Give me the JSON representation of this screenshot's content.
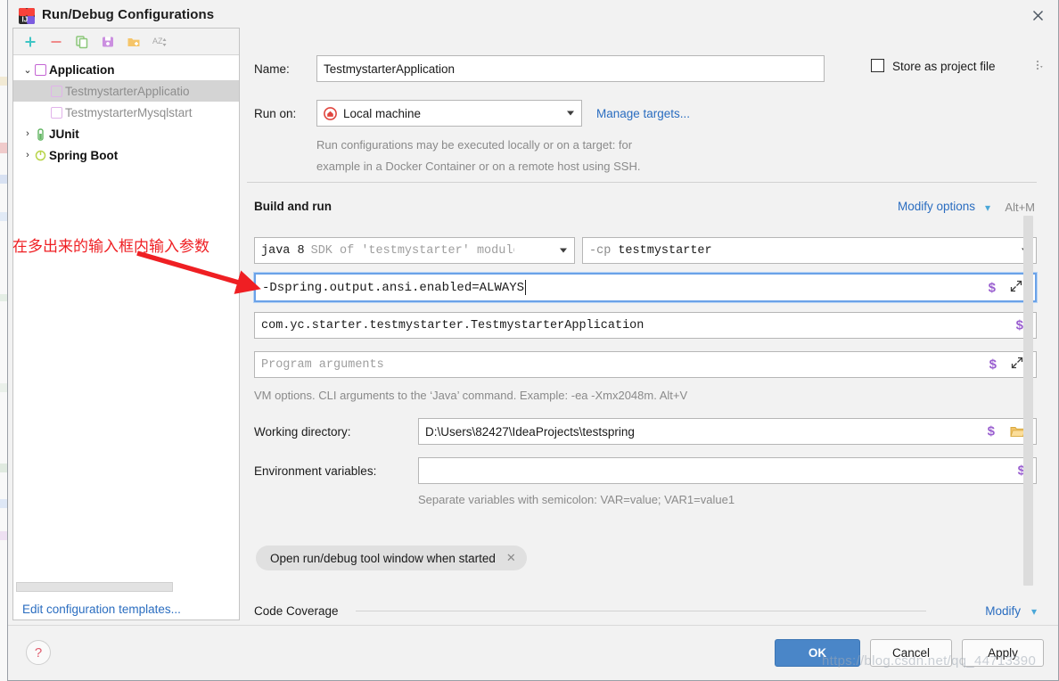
{
  "window": {
    "title": "Run/Debug Configurations",
    "logo_icon": "jetbrains-intellij-logo",
    "close_icon": "close-icon"
  },
  "sidebar": {
    "toolbar": [
      {
        "name": "add",
        "icon": "plus-icon",
        "glyph": "+"
      },
      {
        "name": "remove",
        "icon": "minus-icon",
        "glyph": "−"
      },
      {
        "name": "copy",
        "icon": "copy-icon",
        "glyph": "❐"
      },
      {
        "name": "save",
        "icon": "save-floppy-icon",
        "glyph": "☰"
      },
      {
        "name": "folder",
        "icon": "new-folder-icon",
        "glyph": "+"
      },
      {
        "name": "sort",
        "icon": "sort-alphabetically-icon",
        "glyph": "AZ"
      }
    ],
    "tree": [
      {
        "label": "Application",
        "type": "group",
        "expanded": true,
        "twisty": "⌄",
        "icon": "application-icon"
      },
      {
        "label": "TestmystarterApplicatio",
        "type": "child",
        "selected": true,
        "icon": "run-config-icon"
      },
      {
        "label": "TestmystarterMysqlstart",
        "type": "child",
        "selected": false,
        "icon": "run-config-icon"
      },
      {
        "label": "JUnit",
        "type": "group",
        "expanded": false,
        "twisty": "›",
        "icon": "junit-icon"
      },
      {
        "label": "Spring Boot",
        "type": "group",
        "expanded": false,
        "twisty": "›",
        "icon": "spring-boot-icon"
      }
    ],
    "edit_templates_link": "Edit configuration templates..."
  },
  "form": {
    "name_label": "Name:",
    "name_value": "TestmystarterApplication",
    "store_as_project_file_label": "Store as project file",
    "store_as_project_file_checked": false,
    "run_on_label": "Run on:",
    "run_on_value": "Local machine",
    "run_on_icon": "local-machine-home-icon",
    "manage_targets_link": "Manage targets...",
    "run_on_hint_line1": "Run configurations may be executed locally or on a target: for",
    "run_on_hint_line2": "example in a Docker Container or on a remote host using SSH."
  },
  "build_and_run": {
    "section_title": "Build and run",
    "modify_options_link": "Modify options",
    "modify_options_shortcut": "Alt+M",
    "jre_prefix": "java 8",
    "jre_suffix": "SDK of 'testmystarter' module",
    "classpath_prefix": "-cp",
    "classpath_value": "testmystarter",
    "vm_options_value": "-Dspring.output.ansi.enabled=ALWAYS",
    "main_class_value": "com.yc.starter.testmystarter.TestmystarterApplication",
    "program_arguments_placeholder": "Program arguments",
    "vm_options_hint": "VM options. CLI arguments to the ‘Java’ command. Example: -ea -Xmx2048m. Alt+V",
    "working_directory_label": "Working directory:",
    "working_directory_value": "D:\\Users\\82427\\IdeaProjects\\testspring",
    "working_directory_browse_icon": "folder-open-icon",
    "environment_variables_label": "Environment variables:",
    "environment_variables_value": "",
    "environment_variables_hint": "Separate variables with semicolon: VAR=value; VAR1=value1",
    "macro_icon": "dollar-macro-icon",
    "expand_icon": "expand-editor-icon"
  },
  "chip": {
    "label": "Open run/debug tool window when started",
    "close_icon": "chip-remove-icon"
  },
  "code_coverage": {
    "section_title": "Code Coverage",
    "modify_link": "Modify"
  },
  "footer": {
    "help_icon": "help-question-icon",
    "ok_label": "OK",
    "cancel_label": "Cancel",
    "apply_label": "Apply"
  },
  "annotation": {
    "text": "在多出来的输入框内输入参数",
    "color": "#ef1f23",
    "arrow_icon": "red-pointer-arrow-icon"
  },
  "watermark": {
    "text": "https://blog.csdn.net/qq_44713390"
  },
  "colors": {
    "accent_link": "#2a6dc0",
    "ok_button": "#4a86c8",
    "focus_border": "#6aa2e8",
    "macro_purple": "#9a5fd0",
    "annotation_red": "#ef1f23",
    "dialog_bg": "#f2f2f2"
  }
}
